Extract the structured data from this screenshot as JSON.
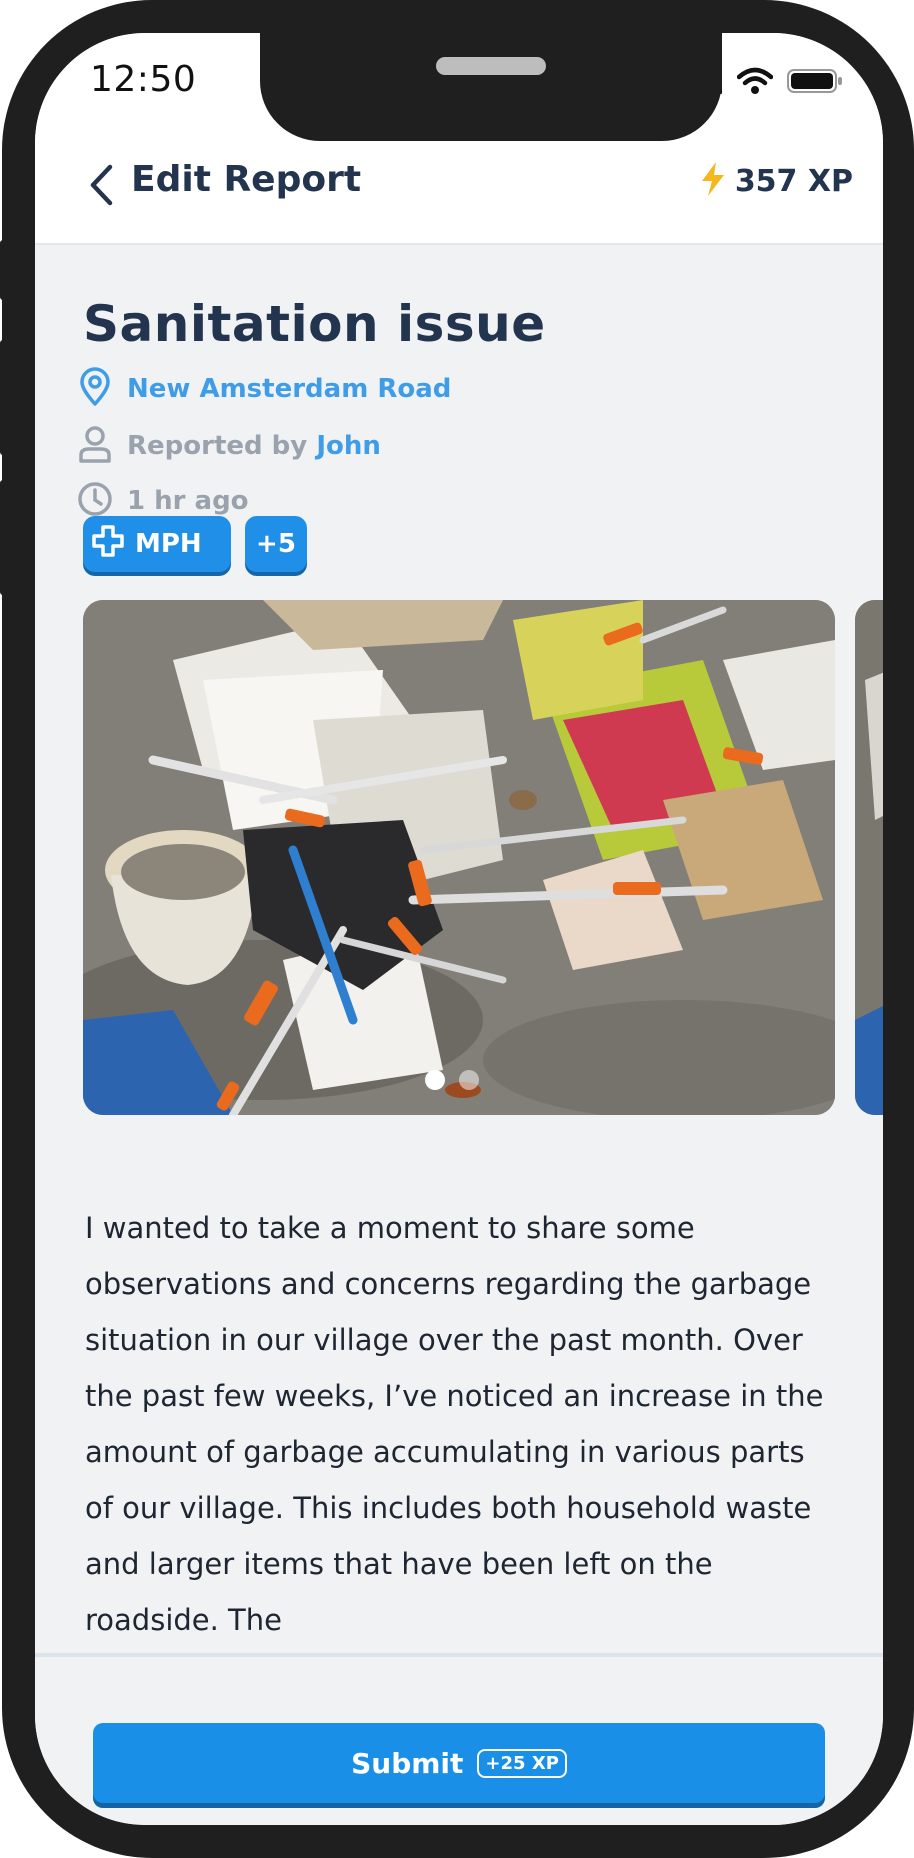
{
  "status_bar": {
    "time": "12:50"
  },
  "header": {
    "title": "Edit Report",
    "xp": "357 XP"
  },
  "report": {
    "title": "Sanitation issue",
    "location": "New Amsterdam Road",
    "reported_by_prefix": "Reported by",
    "reporter": "John",
    "time_ago": "1 hr ago",
    "tags": {
      "primary": "MPH",
      "more": "+5"
    },
    "photos": {
      "count": 2,
      "active_index": 0
    },
    "description": " I wanted to take a moment to share some observations and concerns regarding the garbage situation in our village over the past month. Over the past few weeks, I’ve noticed an increase in the amount of garbage accumulating in various parts of our village. This includes both household waste and larger items that have been left on the roadside. The"
  },
  "footer": {
    "submit_label": "Submit",
    "submit_xp": "+25 XP"
  },
  "colors": {
    "primary": "#1a8fe8",
    "title": "#23344f",
    "muted": "#9aa3ad",
    "link": "#3f9de8",
    "bolt": "#f5b81c"
  },
  "icons": [
    "back-chevron-icon",
    "lightning-bolt-icon",
    "location-pin-icon",
    "user-icon",
    "clock-icon",
    "medical-cross-icon",
    "signal-icon",
    "wifi-icon",
    "battery-icon"
  ]
}
